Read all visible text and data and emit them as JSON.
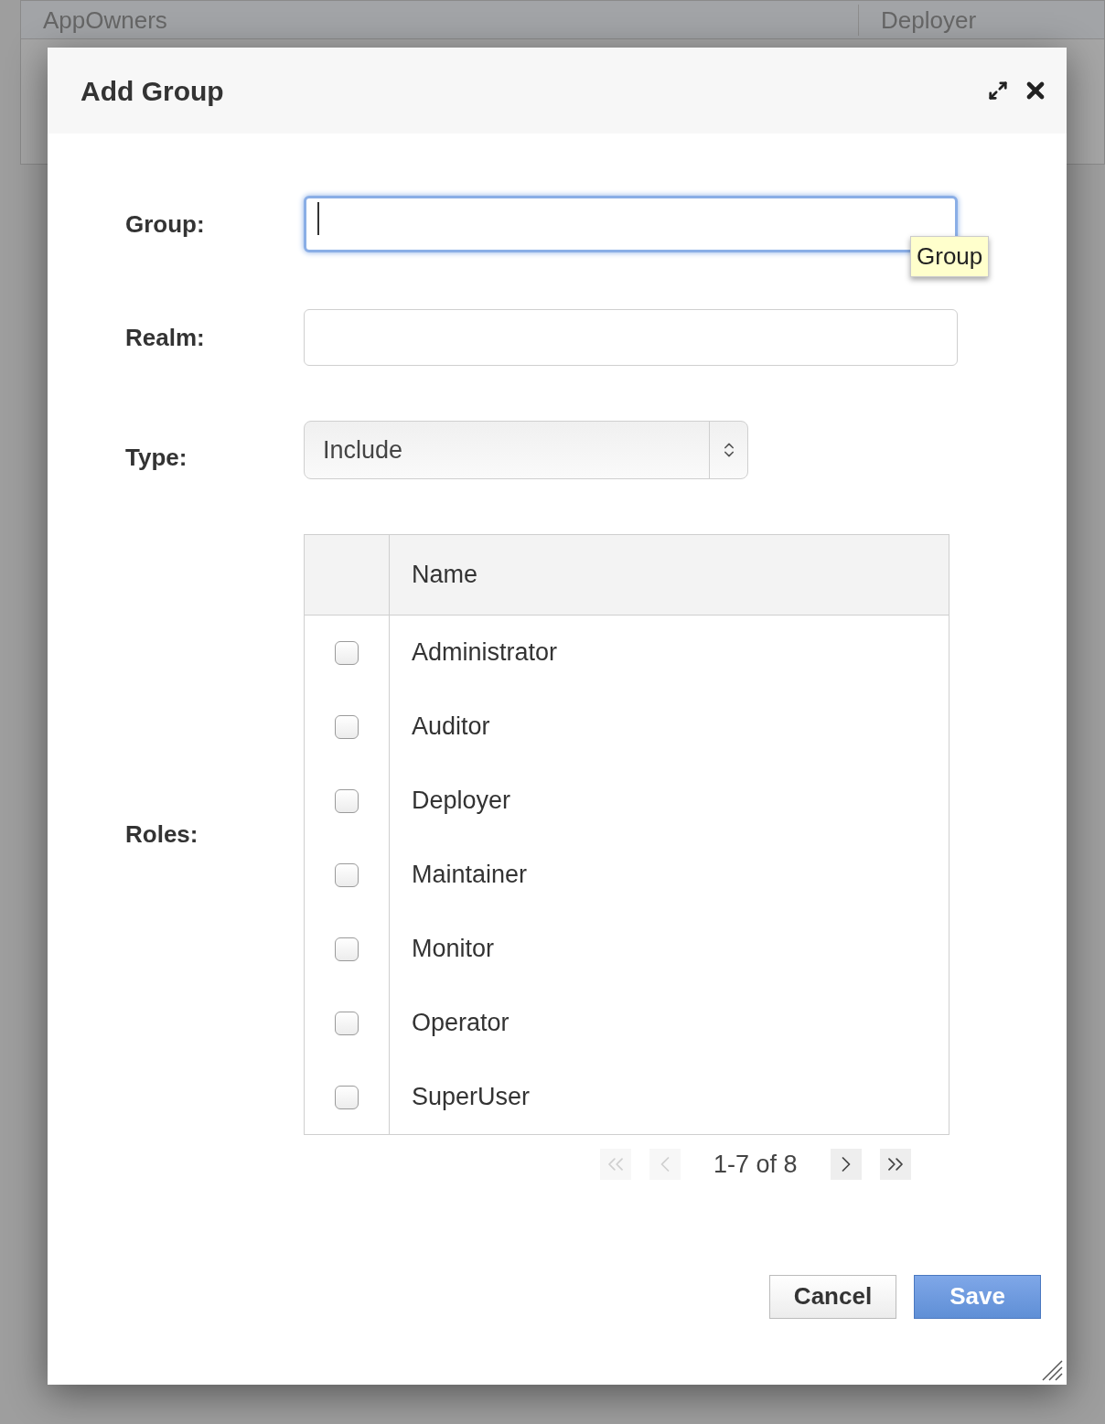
{
  "background_table": {
    "cells": [
      "AppOwners",
      "Deployer"
    ]
  },
  "dialog": {
    "title": "Add Group",
    "group": {
      "label": "Group:",
      "focused": true,
      "tooltip": "Group"
    },
    "realm": {
      "label": "Realm:",
      "focused": false
    },
    "type": {
      "label": "Type:",
      "value": "Include"
    },
    "roles": {
      "label": "Roles:",
      "columns": [
        "Name"
      ],
      "rows": [
        {
          "name": "Administrator",
          "checked": false
        },
        {
          "name": "Auditor",
          "checked": false
        },
        {
          "name": "Deployer",
          "checked": false
        },
        {
          "name": "Maintainer",
          "checked": false
        },
        {
          "name": "Monitor",
          "checked": false
        },
        {
          "name": "Operator",
          "checked": false
        },
        {
          "name": "SuperUser",
          "checked": false
        }
      ],
      "pagination": {
        "range": "1-7 of 8",
        "first_disabled": true,
        "prev_disabled": true,
        "next_disabled": false,
        "last_disabled": false
      }
    },
    "buttons": [
      {
        "label": "Cancel",
        "kind": "secondary"
      },
      {
        "label": "Save",
        "kind": "primary"
      }
    ]
  }
}
